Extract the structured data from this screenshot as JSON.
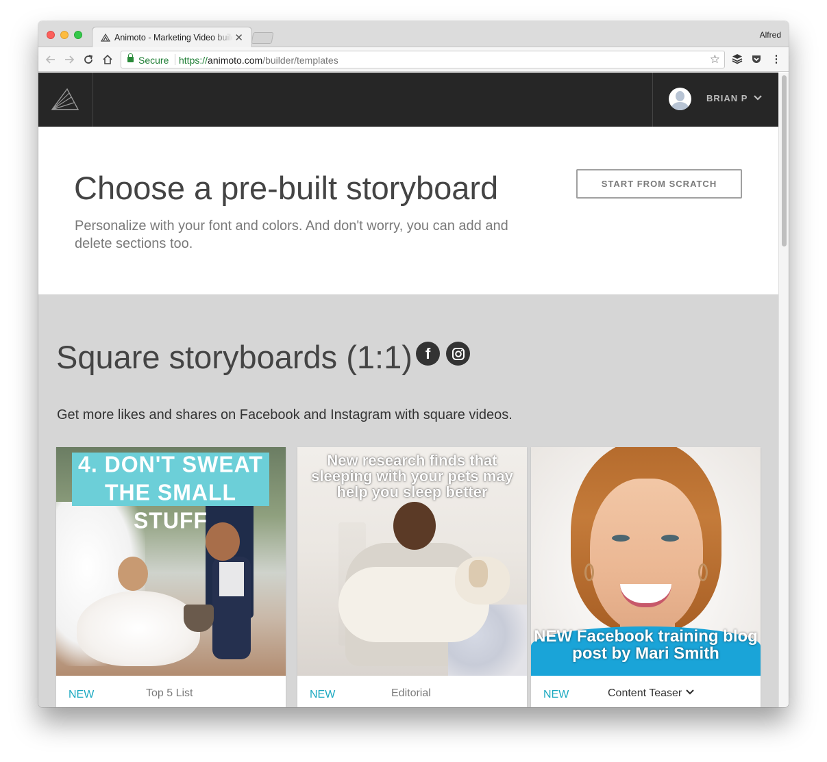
{
  "browser": {
    "tab_title": "Animoto - Marketing Video builder",
    "tab_close": "✕",
    "profile_name": "Alfred",
    "secure_label": "Secure",
    "url_scheme": "https://",
    "url_host": "animoto.com",
    "url_path": "/builder/templates",
    "icons": [
      "back-arrow-icon",
      "forward-arrow-icon",
      "reload-icon",
      "home-icon",
      "lock-icon",
      "bookmark-star-icon",
      "buffer-extension-icon",
      "pocket-extension-icon",
      "menu-dots-icon"
    ]
  },
  "app": {
    "user_name": "BRIAN P",
    "logo_icon": "animoto-logo-icon"
  },
  "hero": {
    "title": "Choose a pre-built storyboard",
    "subtitle": "Personalize with your font and colors. And don't worry, you can add and delete sections too.",
    "start_button": "START FROM SCRATCH"
  },
  "section": {
    "title": "Square storyboards (1:1)",
    "subtitle": "Get more likes and shares on Facebook and Instagram with square videos.",
    "icons": [
      "facebook-icon",
      "instagram-icon"
    ]
  },
  "cards": [
    {
      "badge": "NEW",
      "label": "Top 5 List",
      "thumb_text": "4. DON'T SWEAT THE SMALL STUFF"
    },
    {
      "badge": "NEW",
      "label": "Editorial",
      "thumb_text": "New research finds that sleeping with your pets may help you sleep better"
    },
    {
      "badge": "NEW",
      "label": "Content Teaser",
      "thumb_text": "NEW Facebook training blog post by Mari Smith"
    }
  ],
  "colors": {
    "accent": "#19a8c0",
    "header_bg": "#262626",
    "section_bg": "#d6d6d6"
  }
}
